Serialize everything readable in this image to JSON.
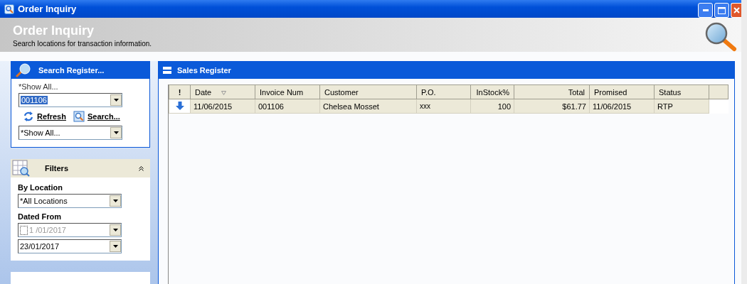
{
  "window": {
    "title": "Order Inquiry"
  },
  "header": {
    "title": "Order Inquiry",
    "subtitle": "Search locations for transaction information."
  },
  "search_panel": {
    "title": "Search Register...",
    "hint": "*Show All...",
    "search_field": {
      "value": "001106",
      "highlighted": true
    },
    "links": [
      {
        "label": "Refresh",
        "kind": "refresh"
      },
      {
        "label": "Search...",
        "kind": "search"
      }
    ],
    "scope_field": {
      "value": "*Show All..."
    }
  },
  "filters_panel": {
    "title": "Filters",
    "expanded": true,
    "fields": [
      {
        "label": "By Location",
        "value": "*All Locations"
      },
      {
        "label": "Dated From",
        "value": "1 /01/2017",
        "checked": false,
        "disabled": true
      },
      {
        "value": "23/01/2017",
        "disabled": false
      }
    ]
  },
  "sales_register": {
    "title": "Sales Register",
    "columns": [
      {
        "label": "!"
      },
      {
        "label": "Date",
        "sorted": true
      },
      {
        "label": "Invoice Num"
      },
      {
        "label": "Customer"
      },
      {
        "label": "P.O."
      },
      {
        "label": "InStock%"
      },
      {
        "label": "Total"
      },
      {
        "label": "Promised"
      },
      {
        "label": "Status"
      }
    ],
    "rows": [
      {
        "cells": [
          "",
          "11/06/2015",
          "001106",
          "Chelsea Mosset",
          "xxx",
          "100",
          "$61.77",
          "11/06/2015",
          "RTP"
        ]
      }
    ]
  }
}
